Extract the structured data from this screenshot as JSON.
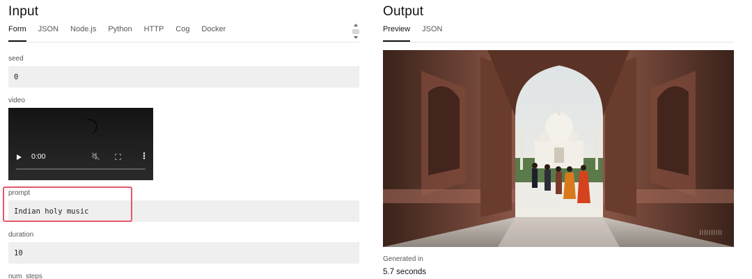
{
  "input": {
    "title": "Input",
    "tabs": [
      {
        "label": "Form"
      },
      {
        "label": "JSON"
      },
      {
        "label": "Node.js"
      },
      {
        "label": "Python"
      },
      {
        "label": "HTTP"
      },
      {
        "label": "Cog"
      },
      {
        "label": "Docker"
      }
    ],
    "active_tab": "Form",
    "fields": {
      "seed": {
        "label": "seed",
        "value": "0"
      },
      "video": {
        "label": "video",
        "time": "0:00"
      },
      "prompt": {
        "label": "prompt",
        "value": "Indian holy music"
      },
      "duration": {
        "label": "duration",
        "value": "10"
      },
      "num_steps": {
        "label": "num_steps"
      }
    }
  },
  "output": {
    "title": "Output",
    "tabs": [
      {
        "label": "Preview"
      },
      {
        "label": "JSON"
      }
    ],
    "active_tab": "Preview",
    "generated_label": "Generated in",
    "generated_value": "5.7 seconds"
  },
  "colors": {
    "highlight": "#e5566b",
    "input_bg": "#efefef",
    "active_tab": "#111111"
  },
  "icons": {
    "play": "play-icon",
    "mute": "muted-speaker-icon",
    "fullscreen": "fullscreen-icon",
    "more": "vertical-dots-icon"
  }
}
